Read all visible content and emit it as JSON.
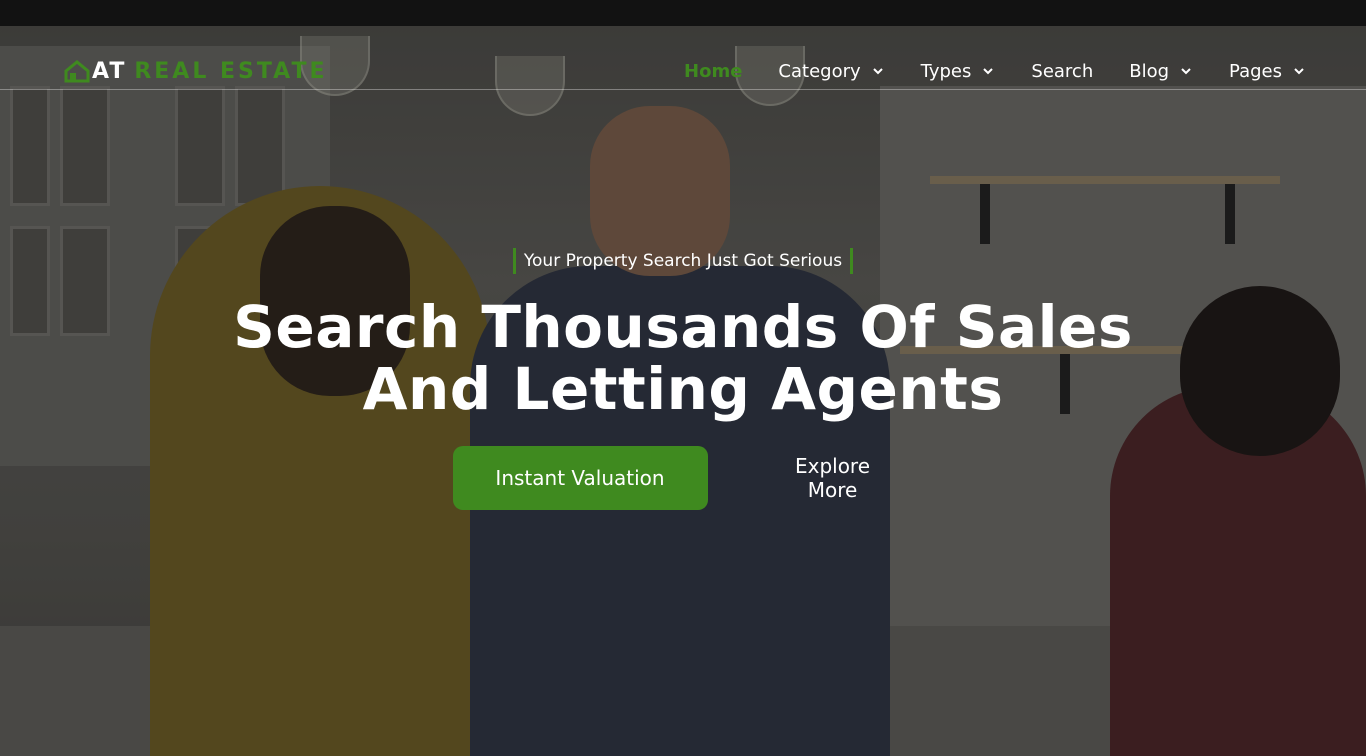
{
  "brand": {
    "name_part1": "AT",
    "name_part2": "REAL ESTATE",
    "accent_color": "#3f8a1f",
    "logo_icon": "house-logo-icon"
  },
  "nav": {
    "items": [
      {
        "label": "Home",
        "active": true,
        "dropdown": false
      },
      {
        "label": "Category",
        "active": false,
        "dropdown": true
      },
      {
        "label": "Types",
        "active": false,
        "dropdown": true
      },
      {
        "label": "Search",
        "active": false,
        "dropdown": false
      },
      {
        "label": "Blog",
        "active": false,
        "dropdown": true
      },
      {
        "label": "Pages",
        "active": false,
        "dropdown": true
      }
    ],
    "dropdown_icon": "chevron-down-icon"
  },
  "hero": {
    "tagline": "Your Property Search Just Got Serious",
    "headline_line1": "Search Thousands Of Sales",
    "headline_line2": "And Letting Agents",
    "primary_button": "Instant Valuation",
    "secondary_button": "Explore More"
  }
}
